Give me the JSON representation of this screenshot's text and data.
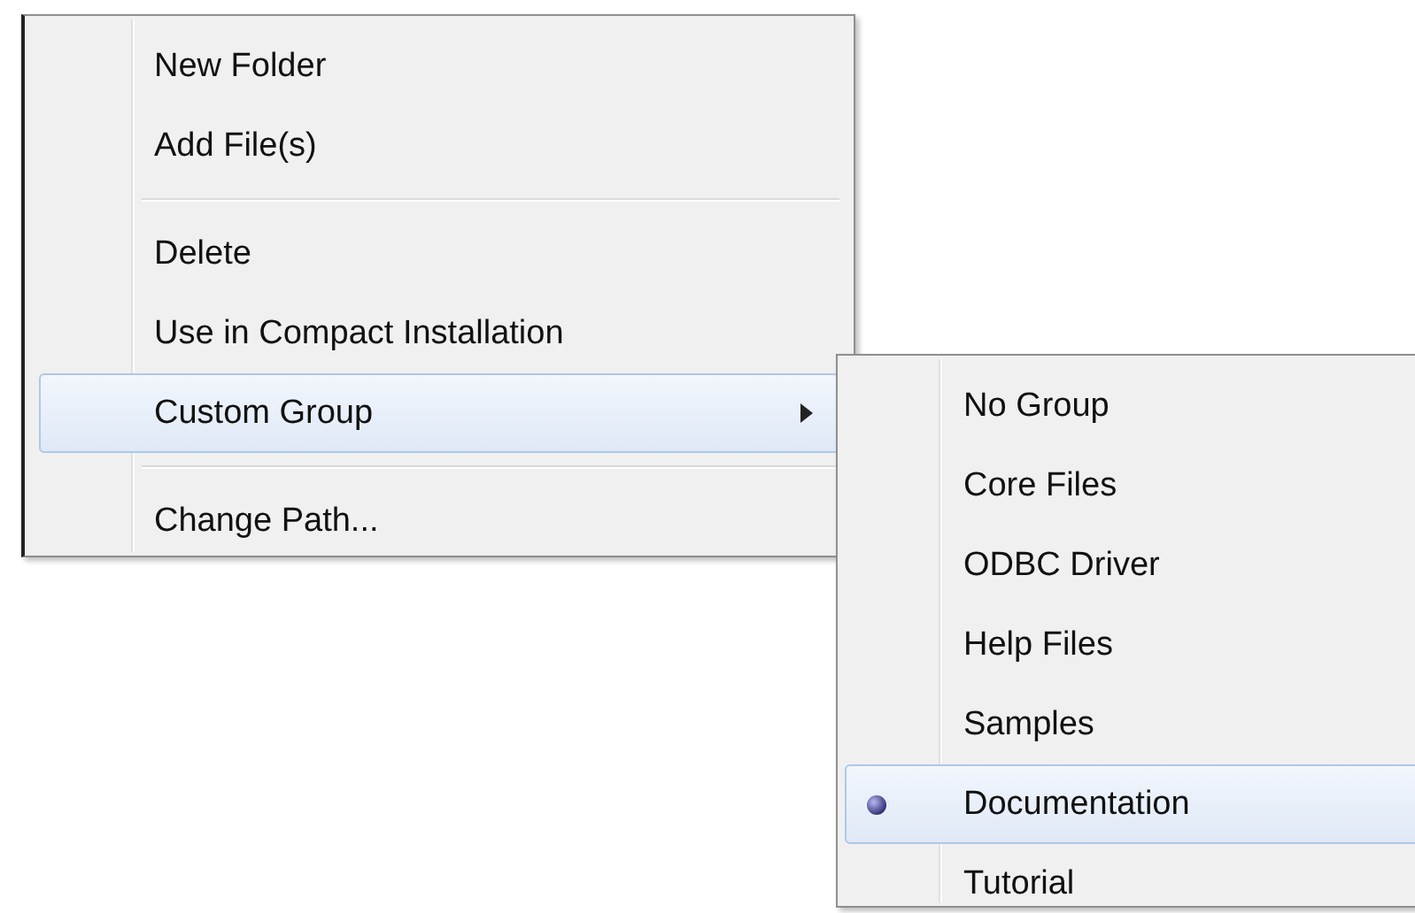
{
  "context_menu": {
    "items": [
      {
        "kind": "item",
        "label": "New Folder",
        "highlighted": false,
        "submenu": false
      },
      {
        "kind": "item",
        "label": "Add File(s)",
        "highlighted": false,
        "submenu": false
      },
      {
        "kind": "separator"
      },
      {
        "kind": "item",
        "label": "Delete",
        "highlighted": false,
        "submenu": false
      },
      {
        "kind": "item",
        "label": "Use in Compact Installation",
        "highlighted": false,
        "submenu": false
      },
      {
        "kind": "item",
        "label": "Custom Group",
        "highlighted": true,
        "submenu": true
      },
      {
        "kind": "separator"
      },
      {
        "kind": "item",
        "label": "Change Path...",
        "highlighted": false,
        "submenu": false
      }
    ]
  },
  "submenu": {
    "items": [
      {
        "label": "No Group",
        "selected": false,
        "highlighted": false
      },
      {
        "label": "Core Files",
        "selected": false,
        "highlighted": false
      },
      {
        "label": "ODBC Driver",
        "selected": false,
        "highlighted": false
      },
      {
        "label": "Help Files",
        "selected": false,
        "highlighted": false
      },
      {
        "label": "Samples",
        "selected": false,
        "highlighted": false
      },
      {
        "label": "Documentation",
        "selected": true,
        "highlighted": true
      },
      {
        "label": "Tutorial",
        "selected": false,
        "highlighted": false
      }
    ]
  }
}
